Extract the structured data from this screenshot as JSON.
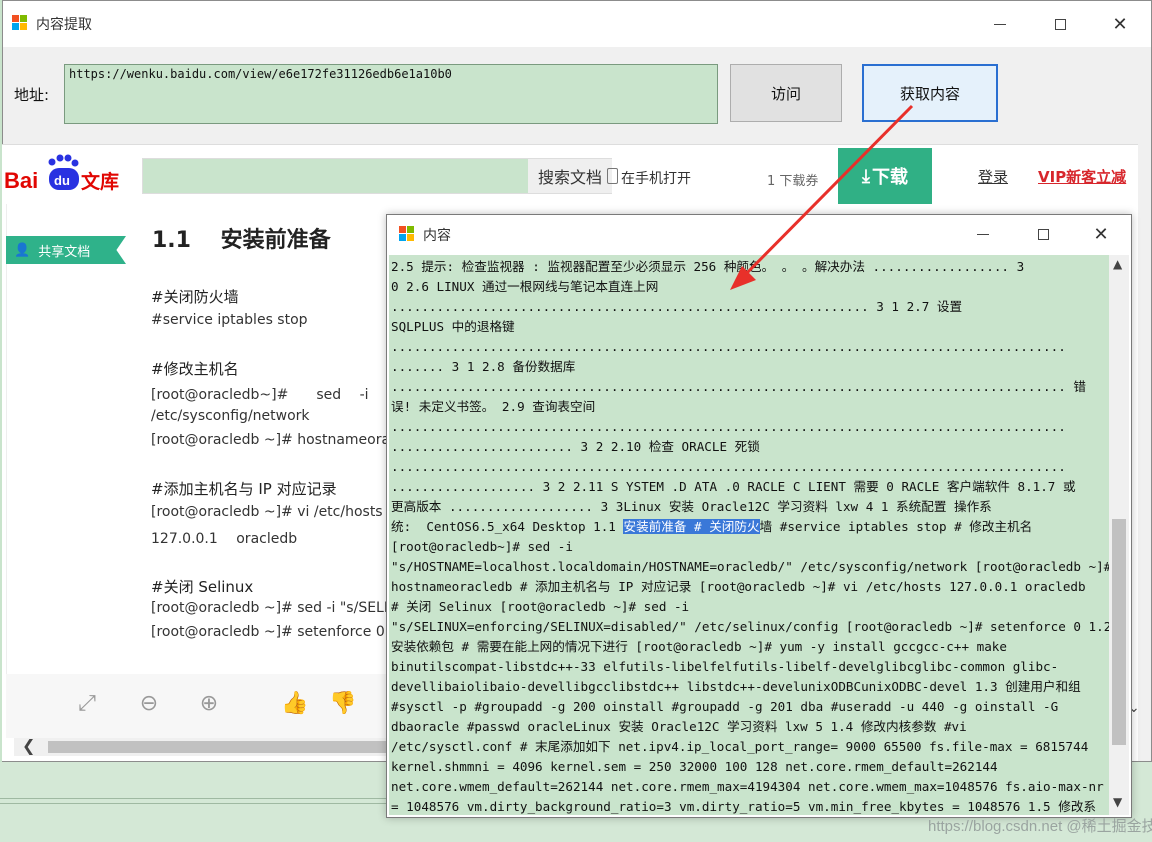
{
  "main_window": {
    "title": "内容提取"
  },
  "address": {
    "label": "地址:",
    "value": "https://wenku.baidu.com/view/e6e172fe31126edb6e1a10b0",
    "visit_label": "访问",
    "fetch_label": "获取内容"
  },
  "baidu": {
    "logo_text_bai": "Bai",
    "logo_text_du": "du",
    "logo_text_wenku": "文库",
    "search_label": "搜索文档",
    "mobile_open": "在手机打开",
    "quota": "1 下载券",
    "download_label": "下载",
    "login": "登录",
    "vip": "VIP新客立减"
  },
  "document": {
    "share_tag": "共享文档",
    "title": "1.1　 安装前准备",
    "lines": [
      "#关闭防火墙",
      "#service iptables stop",
      "#修改主机名",
      "[root@oracledb~]#　　sed　 -i　　\"",
      "/etc/sysconfig/network",
      "[root@oracledb ~]# hostnameoracle",
      "#添加主机名与 IP 对应记录",
      "[root@oracledb ~]# vi /etc/hosts",
      "127.0.0.1　 oracledb",
      "#关闭 Selinux",
      "[root@oracledb ~]# sed -i \"s/SELINU",
      "[root@oracledb ~]# setenforce 0"
    ]
  },
  "content_window": {
    "title": "内容",
    "lines": [
      "2.5 提示: 检查监视器 : 监视器配置至少必须显示 256 种颜色。 。 。解决办法 .................. 3",
      "0 2.6 LINUX 通过一根网线与笔记本直连上网",
      "............................................................... 3 1 2.7 设置",
      "SQLPLUS 中的退格键",
      ".........................................................................................",
      "....... 3 1 2.8 备份数据库",
      "......................................................................................... 错",
      "误! 未定义书签。 2.9 查询表空间",
      ".........................................................................................",
      "........................ 3 2 2.10 检查 ORACLE 死锁",
      ".........................................................................................",
      "................... 3 2 2.11 S YSTEM .D ATA .0 RACLE C LIENT 需要 0 RACLE 客户端软件 8.1.7 或",
      "更高版本 ................... 3 3Linux 安装 Oracle12C 学习资料 lxw 4 1 系统配置 操作系",
      "统:  CentOS6.5_x64 Desktop 1.1 ",
      "[root@oracledb~]# sed -i",
      "\"s/HOSTNAME=localhost.localdomain/HOSTNAME=oracledb/\" /etc/sysconfig/network [root@oracledb ~]#",
      "hostnameoracledb # 添加主机名与 IP 对应记录 [root@oracledb ~]# vi /etc/hosts 127.0.0.1 oracledb",
      "# 关闭 Selinux [root@oracledb ~]# sed -i",
      "\"s/SELINUX=enforcing/SELINUX=disabled/\" /etc/selinux/config [root@oracledb ~]# setenforce 0 1.2",
      "安装依赖包 # 需要在能上网的情况下进行 [root@oracledb ~]# yum -y install gccgcc-c++ make",
      "binutilscompat-libstdc++-33 elfutils-libelfelfutils-libelf-develglibcglibc-common glibc-",
      "devellibaiolibaio-devellibgcclibstdc++ libstdc++-develunixODBCunixODBC-devel 1.3 创建用户和组",
      "#sysctl -p #groupadd -g 200 oinstall #groupadd -g 201 dba #useradd -u 440 -g oinstall -G",
      "dbaoracle #passwd oracleLinux 安装 Oracle12C 学习资料 lxw 5 1.4 修改内核参数 #vi",
      "/etc/sysctl.conf # 末尾添加如下 net.ipv4.ip_local_port_range= 9000 65500 fs.file-max = 6815744",
      "kernel.shmmni = 4096 kernel.sem = 250 32000 100 128 net.core.rmem_default=262144",
      "net.core.wmem_default=262144 net.core.rmem_max=4194304 net.core.wmem_max=1048576 fs.aio-max-nr",
      "= 1048576 vm.dirty_background_ratio=3 vm.dirty_ratio=5 vm.min_free_kbytes = 1048576 1.5 修改系"
    ],
    "selected_text": "安装前准备 # 关闭防火",
    "after_selected": "墙 #service iptables stop # 修改主机名"
  },
  "watermark": "https://blog.csdn.net @稀土掘金技术社区",
  "colors": {
    "green_bg": "#c9e4cc",
    "accent_red": "#e8302a",
    "baidu_green": "#30b085",
    "selection": "#3a78d8"
  }
}
